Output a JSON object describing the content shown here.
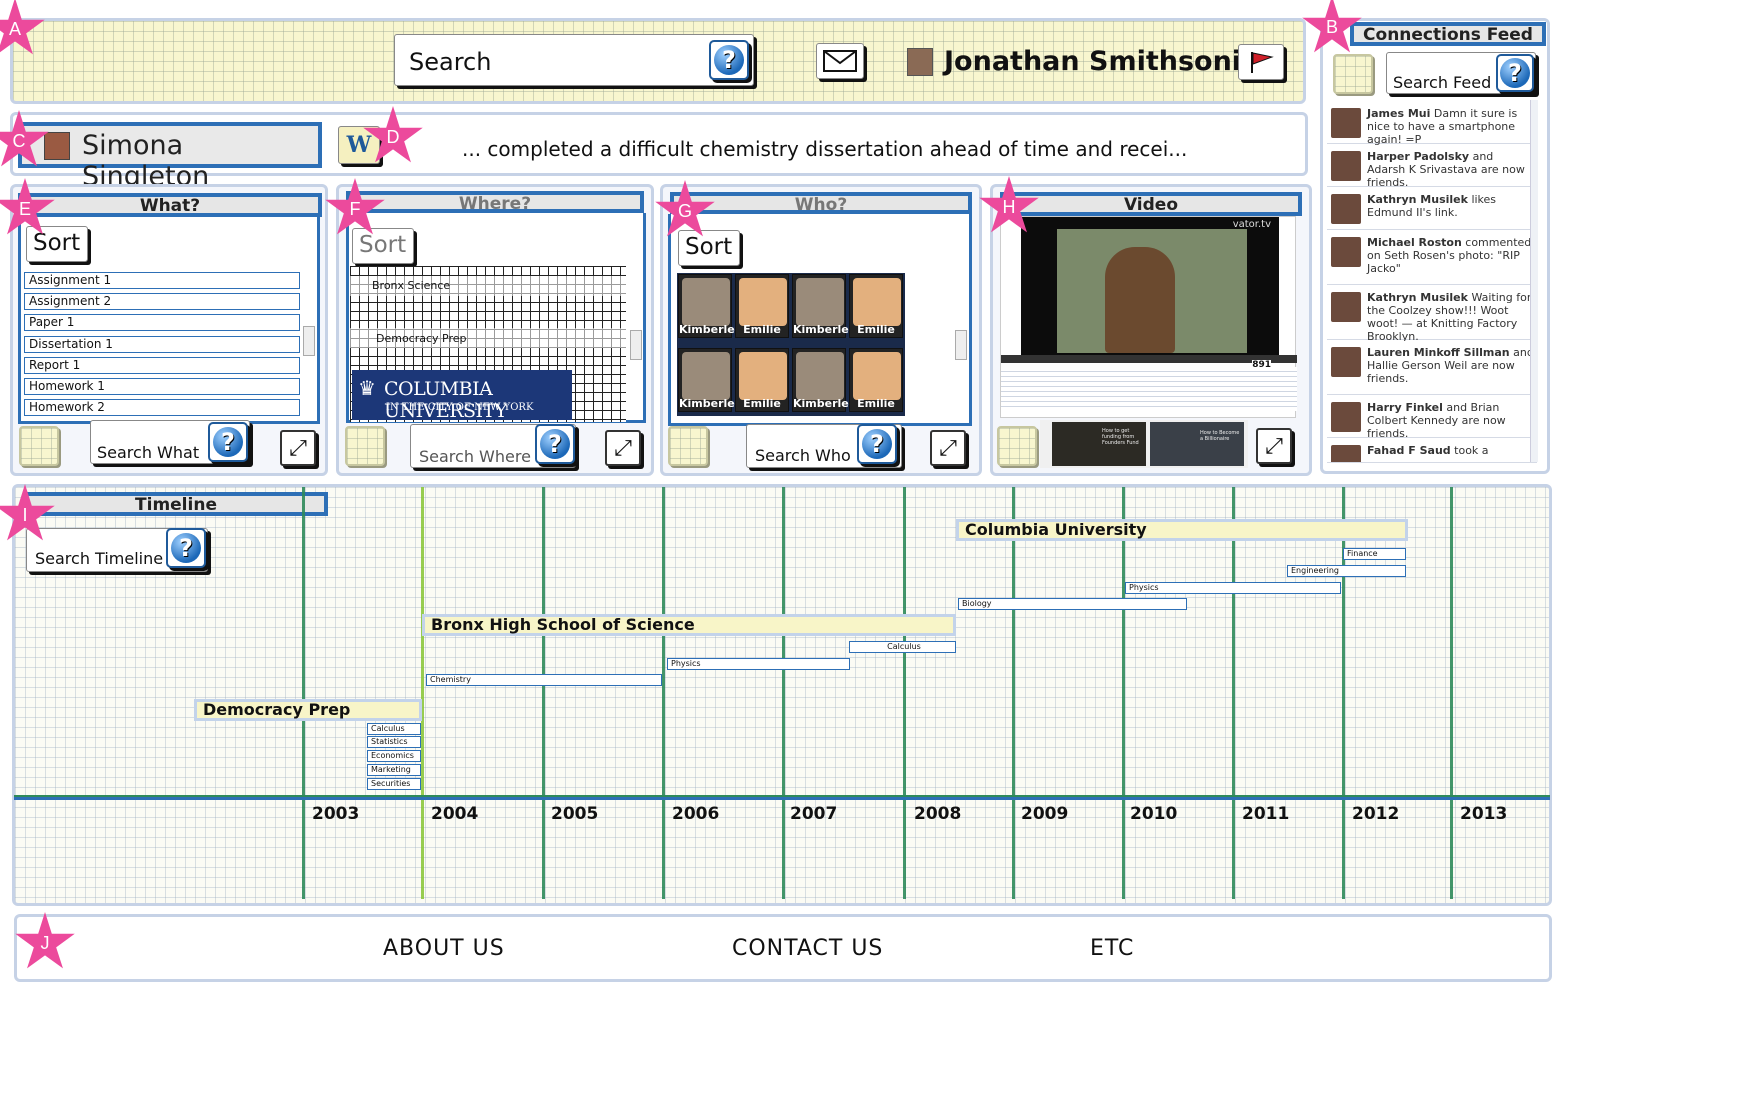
{
  "header": {
    "search_label": "Search",
    "user_name": "Jonathan Smithsonian",
    "mail_icon": "envelope-icon",
    "flag_icon": "flag-icon"
  },
  "feed": {
    "title": "Connections Feed",
    "search_label": "Search Feed",
    "items": [
      {
        "name": "James Mui",
        "text": "Damn it sure is nice to have a smartphone again! =P"
      },
      {
        "name": "Harper Padolsky",
        "text": "and Adarsh K Srivastava are now friends."
      },
      {
        "name": "Kathryn Musilek",
        "text": "likes Edmund II's link."
      },
      {
        "name": "Michael Roston",
        "text": "commented on Seth Rosen's photo: \"RIP Jacko\""
      },
      {
        "name": "Kathryn Musilek",
        "text": "Waiting for the Coolzey show!!! Woot woot! — at Knitting Factory Brooklyn."
      },
      {
        "name": "Lauren Minkoff Sillman",
        "text": "and Hallie Gerson Weil are now friends."
      },
      {
        "name": "Harry Finkel",
        "text": "and Brian Colbert Kennedy are now friends."
      },
      {
        "name": "Fahad F Saud",
        "text": "took a"
      }
    ]
  },
  "profile": {
    "name": "Simona Singleton",
    "status": "... completed a difficult chemistry dissertation ahead of time and recei..."
  },
  "what": {
    "title": "What?",
    "sort_label": "Sort",
    "items": [
      "Assignment 1",
      "Assignment 2",
      "Paper 1",
      "Dissertation 1",
      "Report 1",
      "Homework 1",
      "Homework 2"
    ],
    "search_label": "Search What"
  },
  "where": {
    "title": "Where?",
    "sort_label": "Sort",
    "items": [
      "Bronx Science",
      "Democracy Prep"
    ],
    "logo_line1": "COLUMBIA UNIVERSITY",
    "logo_line2": "IN THE CITY OF NEW YORK",
    "search_label": "Search Where"
  },
  "who": {
    "title": "Who?",
    "sort_label": "Sort",
    "people": [
      "Kimberley",
      "Emilie",
      "Kimberley",
      "Emilie",
      "Kimberley",
      "Emilie",
      "Kimberley",
      "Emilie"
    ],
    "search_label": "Search Who"
  },
  "video": {
    "title": "Video",
    "watermark": "vator.tv",
    "views": "891",
    "thumb1": "How to get funding from Founders Fund",
    "thumb2": "How to Become a Billionaire"
  },
  "timeline": {
    "title": "Timeline",
    "search_label": "Search Timeline",
    "years": [
      "2003",
      "2004",
      "2005",
      "2006",
      "2007",
      "2008",
      "2009",
      "2010",
      "2011",
      "2012",
      "2013"
    ],
    "schools": [
      "Columbia University",
      "Bronx High School of Science",
      "Democracy Prep"
    ],
    "courses": {
      "columbia": [
        "Finance",
        "Engineering",
        "Physics",
        "Biology"
      ],
      "bronx": [
        "Calculus",
        "Physics",
        "Chemistry"
      ],
      "democracy": [
        "Calculus",
        "Statistics",
        "Economics",
        "Marketing",
        "Securities"
      ]
    }
  },
  "markers": [
    "A",
    "B",
    "C",
    "D",
    "E",
    "F",
    "G",
    "H",
    "I",
    "J"
  ],
  "footer": {
    "about": "ABOUT US",
    "contact": "CONTACT US",
    "etc": "ETC"
  },
  "colors": {
    "accent_blue": "#2d6fb6",
    "marker_pink": "#ec4a9c",
    "timeline_green": "#2f8a5a",
    "school_bar_yellow": "#f8f5c8"
  }
}
